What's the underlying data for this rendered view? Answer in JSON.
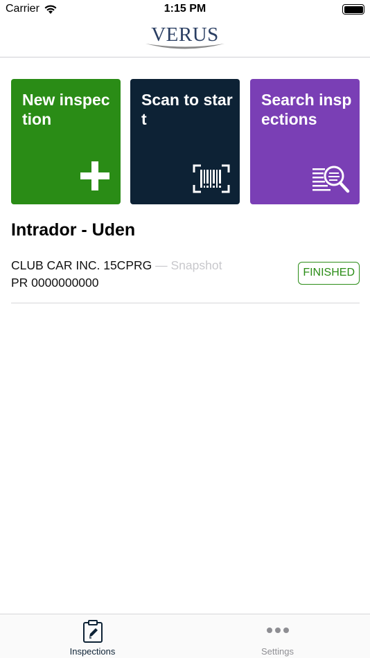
{
  "status_bar": {
    "carrier": "Carrier",
    "time": "1:15 PM"
  },
  "header": {
    "logo_text": "VERUS"
  },
  "tiles": {
    "new": {
      "label": "New inspection",
      "icon": "plus-icon",
      "color": "#2a8c16"
    },
    "scan": {
      "label": "Scan to start",
      "icon": "barcode-scan-icon",
      "color": "#0d2235"
    },
    "search": {
      "label": "Search inspections",
      "icon": "search-list-icon",
      "color": "#7a3fb5"
    }
  },
  "section": {
    "title": "Intrador - Uden"
  },
  "inspections": [
    {
      "name": "CLUB CAR INC. 15CPRG",
      "separator": "—",
      "type": "Snapshot",
      "reference": "PR 0000000000",
      "status": "FINISHED",
      "status_color": "#2a8c16"
    }
  ],
  "tab_bar": {
    "inspections_label": "Inspections",
    "settings_label": "Settings"
  }
}
